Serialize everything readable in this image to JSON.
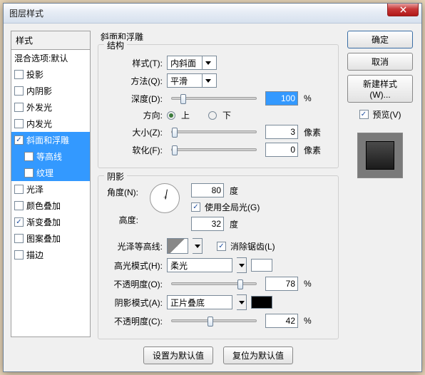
{
  "window": {
    "title": "图层样式"
  },
  "sidebar": {
    "header": "样式",
    "blend": "混合选项:默认",
    "items": [
      {
        "label": "投影",
        "checked": false
      },
      {
        "label": "内阴影",
        "checked": false
      },
      {
        "label": "外发光",
        "checked": false
      },
      {
        "label": "内发光",
        "checked": false
      },
      {
        "label": "斜面和浮雕",
        "checked": true,
        "selected": true
      },
      {
        "label": "等高线",
        "checked": false,
        "sub": true,
        "selected": true
      },
      {
        "label": "纹理",
        "checked": false,
        "sub": true,
        "selected": true
      },
      {
        "label": "光泽",
        "checked": false
      },
      {
        "label": "颜色叠加",
        "checked": false
      },
      {
        "label": "渐变叠加",
        "checked": true
      },
      {
        "label": "图案叠加",
        "checked": false
      },
      {
        "label": "描边",
        "checked": false
      }
    ]
  },
  "panel": {
    "title": "斜面和浮雕",
    "group_structure": "结构",
    "style_label": "样式(T):",
    "style_value": "内斜面",
    "technique_label": "方法(Q):",
    "technique_value": "平滑",
    "depth_label": "深度(D):",
    "depth_value": "100",
    "depth_unit": "%",
    "direction_label": "方向:",
    "dir_up": "上",
    "dir_down": "下",
    "size_label": "大小(Z):",
    "size_value": "3",
    "size_unit": "像素",
    "soften_label": "软化(F):",
    "soften_value": "0",
    "soften_unit": "像素",
    "group_shading": "阴影",
    "angle_label": "角度(N):",
    "angle_value": "80",
    "angle_unit": "度",
    "global_light": "使用全局光(G)",
    "altitude_label": "高度:",
    "altitude_value": "32",
    "altitude_unit": "度",
    "gloss_label": "光泽等高线:",
    "antialias": "消除锯齿(L)",
    "hi_mode_label": "高光模式(H):",
    "hi_mode_value": "柔光",
    "hi_color": "#ffffff",
    "hi_opacity_label": "不透明度(O):",
    "hi_opacity_value": "78",
    "percent": "%",
    "sh_mode_label": "阴影模式(A):",
    "sh_mode_value": "正片叠底",
    "sh_color": "#000000",
    "sh_opacity_label": "不透明度(C):",
    "sh_opacity_value": "42",
    "btn_default": "设置为默认值",
    "btn_reset": "复位为默认值"
  },
  "buttons": {
    "ok": "确定",
    "cancel": "取消",
    "new_style": "新建样式(W)...",
    "preview": "预览(V)"
  }
}
